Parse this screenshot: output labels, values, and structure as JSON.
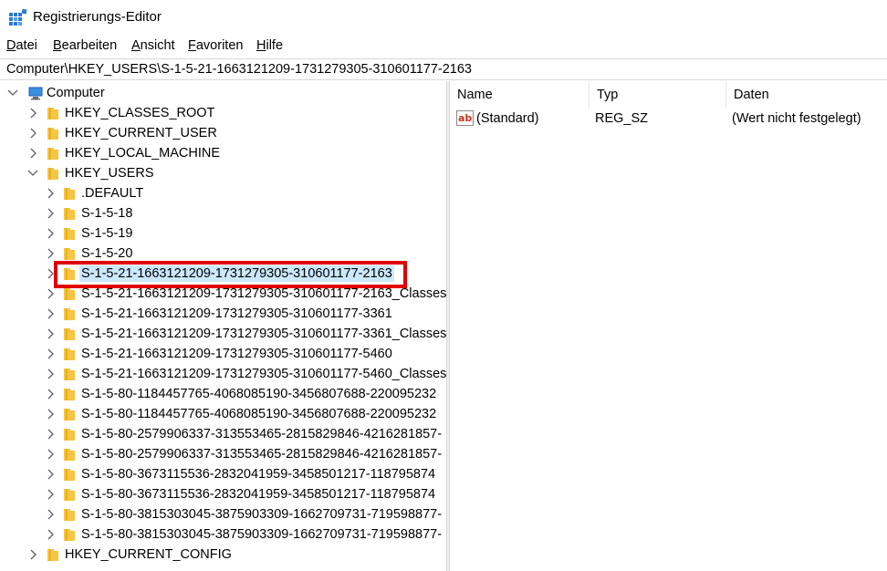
{
  "window": {
    "title": "Registrierungs-Editor",
    "icon": "regedit-icon"
  },
  "menu": {
    "items": [
      "Datei",
      "Bearbeiten",
      "Ansicht",
      "Favoriten",
      "Hilfe"
    ]
  },
  "address": {
    "path": "Computer\\HKEY_USERS\\S-1-5-21-1663121209-1731279305-310601177-2163"
  },
  "tree": {
    "root": "Computer",
    "hives": [
      "HKEY_CLASSES_ROOT",
      "HKEY_CURRENT_USER",
      "HKEY_LOCAL_MACHINE",
      "HKEY_USERS",
      "HKEY_CURRENT_CONFIG"
    ],
    "users": [
      ".DEFAULT",
      "S-1-5-18",
      "S-1-5-19",
      "S-1-5-20",
      "S-1-5-21-1663121209-1731279305-310601177-2163",
      "S-1-5-21-1663121209-1731279305-310601177-2163_Classes",
      "S-1-5-21-1663121209-1731279305-310601177-3361",
      "S-1-5-21-1663121209-1731279305-310601177-3361_Classes",
      "S-1-5-21-1663121209-1731279305-310601177-5460",
      "S-1-5-21-1663121209-1731279305-310601177-5460_Classes",
      "S-1-5-80-1184457765-4068085190-3456807688-220095232",
      "S-1-5-80-1184457765-4068085190-3456807688-220095232",
      "S-1-5-80-2579906337-313553465-2815829846-4216281857-",
      "S-1-5-80-2579906337-313553465-2815829846-4216281857-",
      "S-1-5-80-3673115536-2832041959-3458501217-118795874",
      "S-1-5-80-3673115536-2832041959-3458501217-118795874",
      "S-1-5-80-3815303045-3875903309-1662709731-719598877-",
      "S-1-5-80-3815303045-3875903309-1662709731-719598877-"
    ],
    "selected": "S-1-5-21-1663121209-1731279305-310601177-2163"
  },
  "list": {
    "columns": [
      "Name",
      "Typ",
      "Daten"
    ],
    "rows": [
      {
        "name": "(Standard)",
        "type": "REG_SZ",
        "data": "(Wert nicht festgelegt)",
        "icon": "string-value-icon"
      }
    ]
  },
  "colors": {
    "selection": "#cce8ff",
    "highlight_border": "#e00000",
    "folder": "#f6c542"
  }
}
